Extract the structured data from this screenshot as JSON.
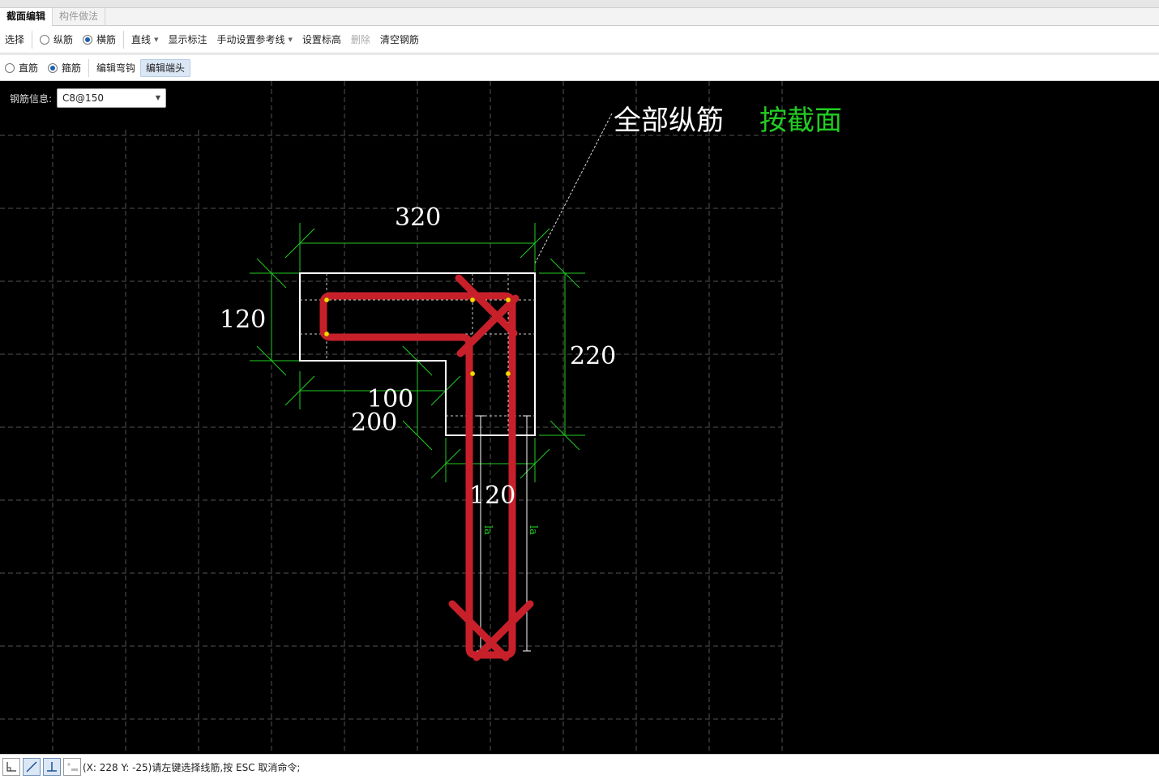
{
  "tabs": [
    {
      "label": "截面编辑",
      "active": true
    },
    {
      "label": "构件做法",
      "active": false
    }
  ],
  "toolbar1": {
    "select": "选择",
    "radio_longitudinal": {
      "label": "纵筋",
      "checked": false
    },
    "radio_transverse": {
      "label": "横筋",
      "checked": true
    },
    "line_mode": "直线",
    "show_dimension": "显示标注",
    "manual_ref_line": "手动设置参考线",
    "set_elevation": "设置标高",
    "delete": "删除",
    "clear_rebar": "清空钢筋"
  },
  "toolbar2": {
    "radio_straight": {
      "label": "直筋",
      "checked": false
    },
    "radio_stirrup": {
      "label": "箍筋",
      "checked": true
    },
    "edit_hook": "编辑弯钩",
    "edit_end": "编辑端头"
  },
  "rebar_info": {
    "label": "钢筋信息:",
    "value": "C8@150"
  },
  "drawing": {
    "label_all": "全部纵筋",
    "label_section": "按截面",
    "dim_320": "320",
    "dim_120_left": "120",
    "dim_220": "220",
    "dim_100": "100",
    "dim_200": "200",
    "dim_120_bottom": "120",
    "la_1": "la",
    "la_2": "la"
  },
  "colors": {
    "rebar": "#c8202a",
    "dimension": "#22cc22",
    "outline": "#ffffff",
    "grid": "#555555",
    "point": "#ffd700"
  },
  "statusbar": {
    "text": "(X: 228 Y: -25)请左键选择线筋,按 ESC 取消命令;"
  }
}
